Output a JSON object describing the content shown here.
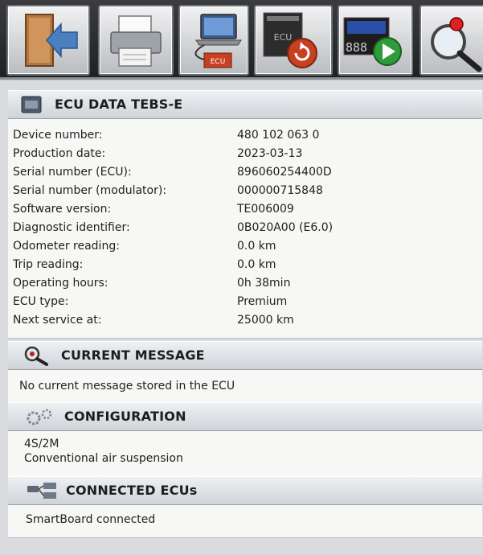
{
  "toolbar": {
    "buttons": [
      {
        "name": "exit-button",
        "icon": "door-exit-arrow-icon"
      },
      {
        "name": "print-button",
        "icon": "printer-icon"
      },
      {
        "name": "connect-ecu-button",
        "icon": "laptop-ecu-connection-icon",
        "badge": "ECU"
      },
      {
        "name": "reset-ecu-button",
        "icon": "ecu-reset-icon",
        "badge": "ECU"
      },
      {
        "name": "start-diagnosis-button",
        "icon": "display-play-icon",
        "badge": "888"
      },
      {
        "name": "search-button",
        "icon": "magnifier-icon"
      }
    ]
  },
  "ecu_data": {
    "title": "ECU DATA TEBS-E",
    "rows": [
      {
        "label": "Device number:",
        "value": "480 102 063 0"
      },
      {
        "label": "Production date:",
        "value": "2023-03-13"
      },
      {
        "label": "Serial number (ECU):",
        "value": "896060254400D"
      },
      {
        "label": "Serial number (modulator):",
        "value": "000000715848"
      },
      {
        "label": "Software version:",
        "value": "TE006009"
      },
      {
        "label": "Diagnostic identifier:",
        "value": "0B020A00 (E6.0)"
      },
      {
        "label": "Odometer reading:",
        "value": "0.0 km"
      },
      {
        "label": "Trip reading:",
        "value": "0.0 km"
      },
      {
        "label": "Operating hours:",
        "value": "0h 38min"
      },
      {
        "label": "ECU type:",
        "value": "Premium"
      },
      {
        "label": "Next service at:",
        "value": "25000 km"
      }
    ]
  },
  "current_message": {
    "title": "CURRENT MESSAGE",
    "text": "No current message stored in the ECU"
  },
  "configuration": {
    "title": "CONFIGURATION",
    "lines": [
      "4S/2M",
      "Conventional air suspension"
    ]
  },
  "connected_ecus": {
    "title": "CONNECTED ECUs",
    "text": "SmartBoard connected"
  },
  "colors": {
    "toolbar_bg": "#2a2c30",
    "section_header": "#dde0e4",
    "body_bg": "#f7f7f5",
    "play_green": "#2e9b3c",
    "reset_red": "#c8401f"
  }
}
